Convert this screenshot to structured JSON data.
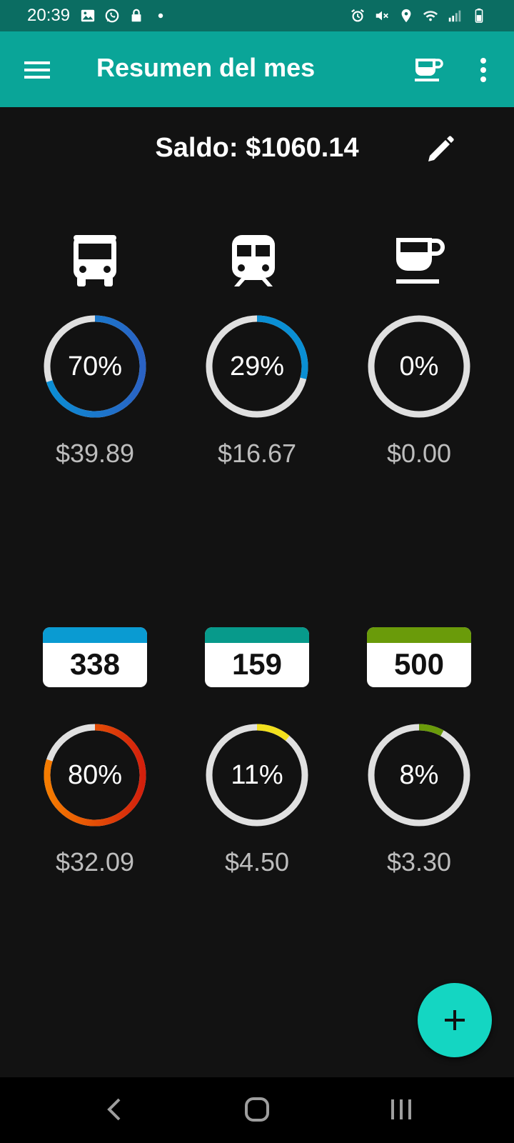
{
  "status_bar": {
    "time": "20:39",
    "left_icons": [
      "image-icon",
      "whatsapp-icon",
      "lock-icon",
      "dot-icon"
    ],
    "right_icons": [
      "alarm-icon",
      "mute-icon",
      "location-icon",
      "wifi-icon",
      "signal-icon",
      "battery-icon"
    ]
  },
  "app_bar": {
    "title": "Resumen del mes",
    "icons": [
      "menu-icon",
      "coffee-cup-icon",
      "more-vert-icon"
    ],
    "background": "#0aa598"
  },
  "balance": {
    "text": "Saldo: $1060.14",
    "edit_icon": "pencil-icon"
  },
  "categories_row1": [
    {
      "icon": "bus-icon",
      "percent_label": "70%",
      "percent": 70,
      "amount": "$39.89",
      "ring_colors": [
        "#0a8fd4",
        "#2a62c4"
      ]
    },
    {
      "icon": "train-icon",
      "percent_label": "29%",
      "percent": 29,
      "amount": "$16.67",
      "ring_colors": [
        "#0a8fd4",
        "#0a8fd4"
      ]
    },
    {
      "icon": "coffee-icon",
      "percent_label": "0%",
      "percent": 0,
      "amount": "$0.00",
      "ring_colors": [
        "#0a8fd4",
        "#0a8fd4"
      ]
    }
  ],
  "categories_row2": [
    {
      "badge": "338",
      "band_color": "#0a9bd2",
      "percent_label": "80%",
      "percent": 80,
      "amount": "$32.09",
      "ring_colors": [
        "#f57c00",
        "#d3200c"
      ]
    },
    {
      "badge": "159",
      "band_color": "#079a8b",
      "percent_label": "11%",
      "percent": 11,
      "amount": "$4.50",
      "ring_colors": [
        "#f2e01d",
        "#f2e01d"
      ]
    },
    {
      "badge": "500",
      "band_color": "#6a9b0a",
      "percent_label": "8%",
      "percent": 8,
      "amount": "$3.30",
      "ring_colors": [
        "#6a9b0a",
        "#6a9b0a"
      ]
    }
  ],
  "fab": {
    "icon": "plus-icon",
    "color": "#14d6c2"
  },
  "nav_bar": {
    "icons": [
      "back-icon",
      "home-icon",
      "recents-icon"
    ]
  }
}
